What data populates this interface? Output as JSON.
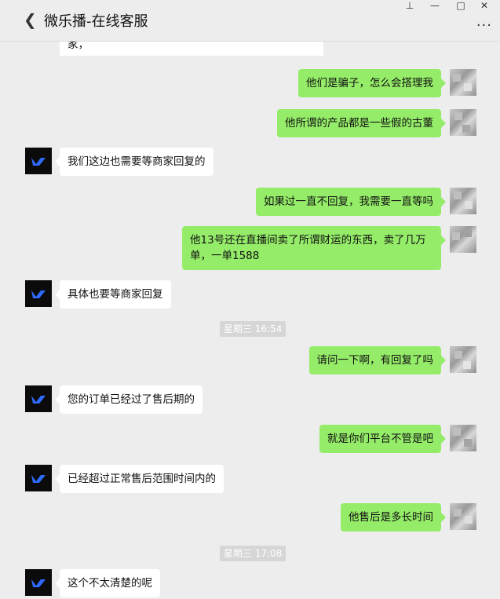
{
  "window": {
    "title": "微乐播-在线客服",
    "controls": {
      "pin": "⊥",
      "minimize": "—",
      "maximize": "□",
      "close": "✕"
    },
    "more": "···"
  },
  "chat": {
    "top_fragment": "家，",
    "messages": [
      {
        "side": "out",
        "text": "他们是骗子，怎么会搭理我"
      },
      {
        "side": "out",
        "text": "他所谓的产品都是一些假的古董"
      },
      {
        "side": "in",
        "text": "我们这边也需要等商家回复的"
      },
      {
        "side": "out",
        "text": "如果过一直不回复，我需要一直等吗"
      },
      {
        "side": "out",
        "text": "他13号还在直播间卖了所谓财运的东西，卖了几万单，一单1588"
      },
      {
        "side": "in",
        "text": "具体也要等商家回复"
      },
      {
        "side": "time",
        "text": "星期三 16:54"
      },
      {
        "side": "out",
        "text": "请问一下啊，有回复了吗"
      },
      {
        "side": "in",
        "text": "您的订单已经过了售后期的"
      },
      {
        "side": "out",
        "text": "就是你们平台不管是吧"
      },
      {
        "side": "in",
        "text": "已经超过正常售后范围时间内的"
      },
      {
        "side": "out",
        "text": "他售后是多长时间"
      },
      {
        "side": "time",
        "text": "星期三 17:08"
      },
      {
        "side": "in",
        "text": "这个不太清楚的呢"
      }
    ]
  },
  "colors": {
    "outgoing": "#95ec69",
    "incoming": "#ffffff",
    "background": "#ededed"
  }
}
